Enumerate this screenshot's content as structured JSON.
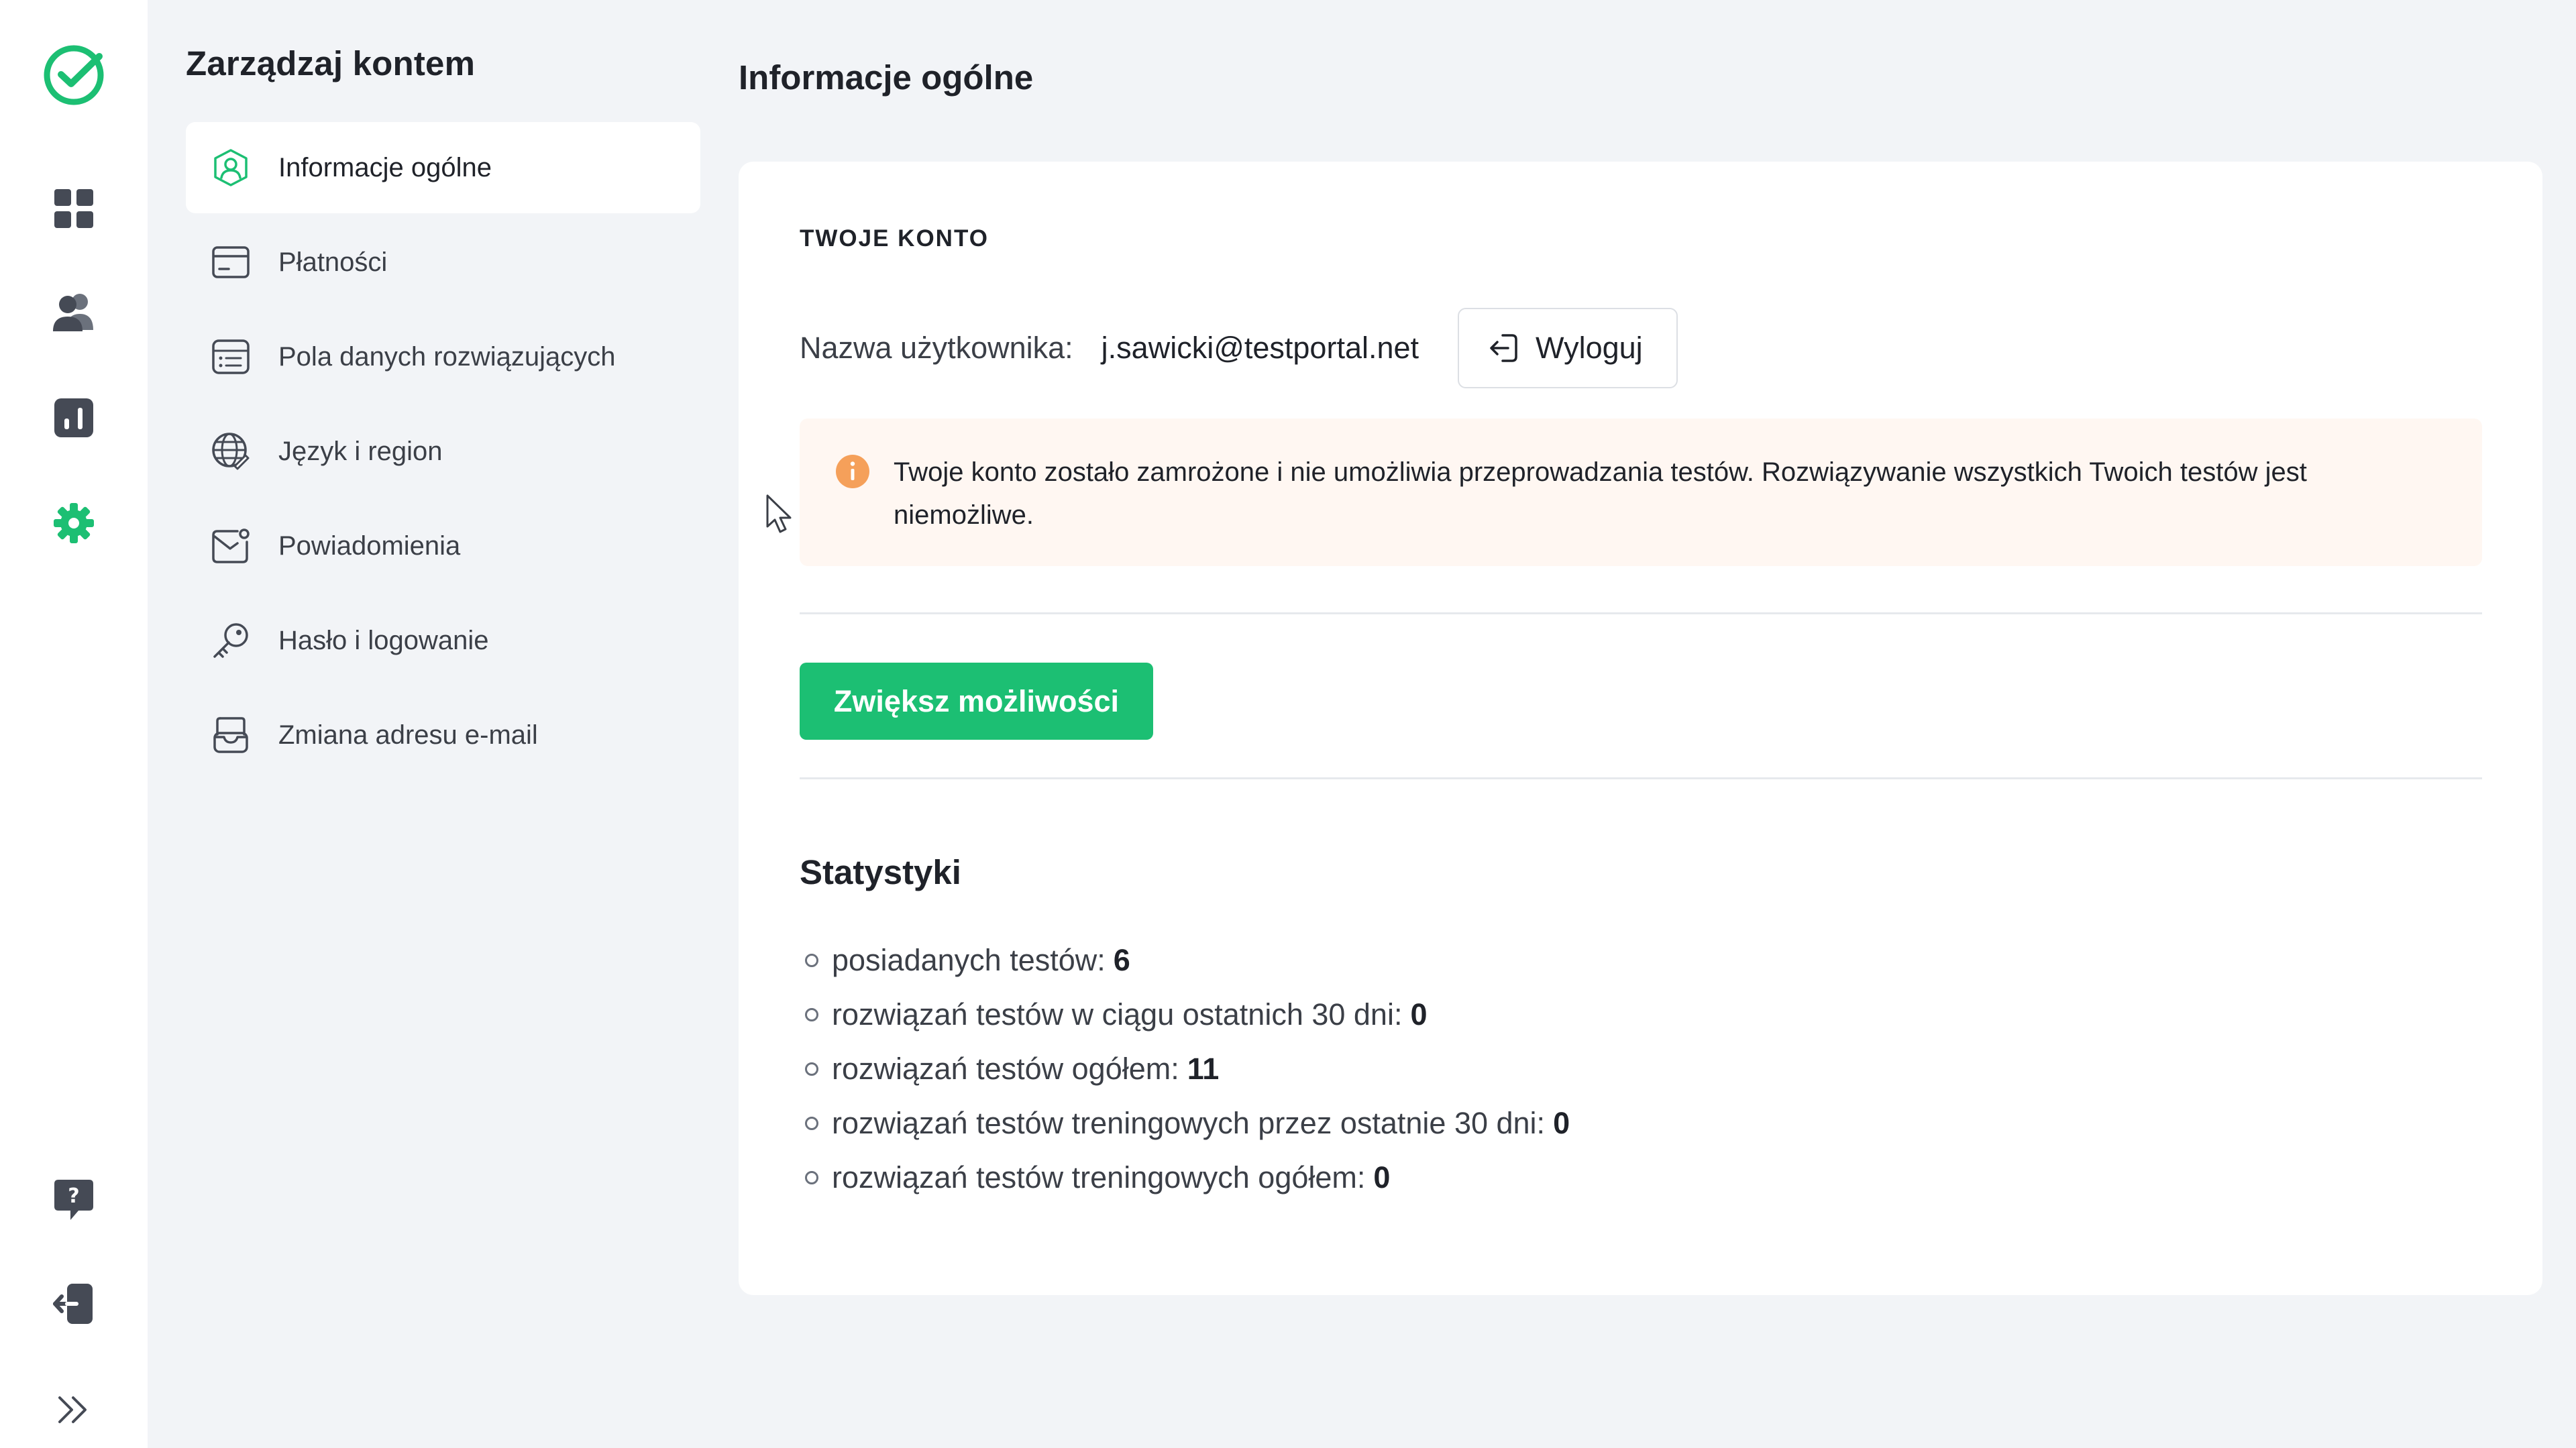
{
  "colors": {
    "brand": "#1cbf73",
    "rail_icon": "#454a55",
    "active_icon": "#1cbf73",
    "alert_icon": "#f5a05a",
    "alert_bg": "#fff7f2"
  },
  "rail": {
    "items": [
      {
        "icon": "logo-check-icon"
      },
      {
        "icon": "dashboard-grid-icon"
      },
      {
        "icon": "users-icon"
      },
      {
        "icon": "bar-chart-icon"
      },
      {
        "icon": "gear-icon",
        "active": true
      },
      {
        "icon": "help-bubble-icon"
      },
      {
        "icon": "sign-out-icon"
      },
      {
        "icon": "expand-chevrons-icon"
      }
    ]
  },
  "menu": {
    "title": "Zarządzaj kontem",
    "items": [
      {
        "label": "Informacje ogólne",
        "icon": "user-badge-icon",
        "active": true
      },
      {
        "label": "Płatności",
        "icon": "credit-card-icon"
      },
      {
        "label": "Pola danych rozwiązujących",
        "icon": "data-fields-icon"
      },
      {
        "label": "Język i region",
        "icon": "globe-icon"
      },
      {
        "label": "Powiadomienia",
        "icon": "notification-mail-icon"
      },
      {
        "label": "Hasło i logowanie",
        "icon": "key-icon"
      },
      {
        "label": "Zmiana adresu e-mail",
        "icon": "inbox-icon"
      }
    ]
  },
  "main": {
    "title": "Informacje ogólne",
    "section_label": "TWOJE KONTO",
    "username_label": "Nazwa użytkownika:",
    "username_value": "j.sawicki@testportal.net",
    "logout_label": "Wyloguj",
    "alert_text": "Twoje konto zostało zamrożone i nie umożliwia przeprowadzania testów. Rozwiązywanie wszystkich Twoich testów jest niemożliwe.",
    "upgrade_label": "Zwiększ możliwości",
    "stats_title": "Statystyki",
    "stats": [
      {
        "label": "posiadanych testów:",
        "value": "6"
      },
      {
        "label": "rozwiązań testów w ciągu ostatnich 30 dni:",
        "value": "0"
      },
      {
        "label": "rozwiązań testów ogółem:",
        "value": "11"
      },
      {
        "label": "rozwiązań testów treningowych przez ostatnie 30 dni:",
        "value": "0"
      },
      {
        "label": "rozwiązań testów treningowych ogółem:",
        "value": "0"
      }
    ]
  }
}
